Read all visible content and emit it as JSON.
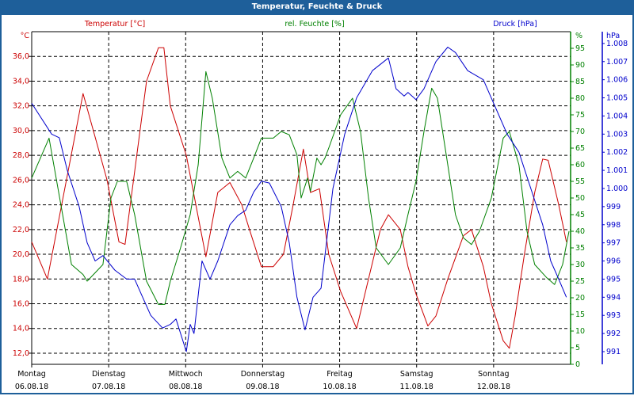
{
  "window": {
    "title": "Temperatur, Feuchte & Druck"
  },
  "chart_data": {
    "type": "line",
    "title": "Temperatur, Feuchte & Druck",
    "x_unit": "hours since Montag 06.08.18 00:00",
    "xlim": [
      0,
      168
    ],
    "days": [
      {
        "name": "Montag",
        "date": "06.08.18"
      },
      {
        "name": "Dienstag",
        "date": "07.08.18"
      },
      {
        "name": "Mittwoch",
        "date": "08.08.18"
      },
      {
        "name": "Donnerstag",
        "date": "09.08.18"
      },
      {
        "name": "Freitag",
        "date": "10.08.18"
      },
      {
        "name": "Samstag",
        "date": "11.08.18"
      },
      {
        "name": "Sonntag",
        "date": "12.08.18"
      }
    ],
    "axes": {
      "temp": {
        "label": "Temperatur [°C]",
        "unit": "°C",
        "ylim": [
          11.1,
          38
        ],
        "ticks": [
          "12,0",
          "14,0",
          "16,0",
          "18,0",
          "20,0",
          "22,0",
          "24,0",
          "26,0",
          "28,0",
          "30,0",
          "32,0",
          "34,0",
          "36,0"
        ],
        "tick_values": [
          12,
          14,
          16,
          18,
          20,
          22,
          24,
          26,
          28,
          30,
          32,
          34,
          36
        ],
        "color": "#cc0000"
      },
      "hum": {
        "label": "rel. Feuchte [%]",
        "unit": "%",
        "ylim": [
          0,
          100
        ],
        "ticks": [
          "0",
          "5",
          "10",
          "15",
          "20",
          "25",
          "30",
          "35",
          "40",
          "45",
          "50",
          "55",
          "60",
          "65",
          "70",
          "75",
          "80",
          "85",
          "90",
          "95"
        ],
        "tick_values": [
          0,
          5,
          10,
          15,
          20,
          25,
          30,
          35,
          40,
          45,
          50,
          55,
          60,
          65,
          70,
          75,
          80,
          85,
          90,
          95
        ],
        "color": "#008000"
      },
      "press": {
        "label": "Druck [hPa]",
        "unit": "hPa",
        "ylim": [
          990.3,
          1008.65
        ],
        "ticks": [
          "991",
          "992",
          "993",
          "994",
          "995",
          "996",
          "997",
          "998",
          "999",
          "1.000",
          "1.001",
          "1.002",
          "1.003",
          "1.004",
          "1.005",
          "1.006",
          "1.007",
          "1.008"
        ],
        "tick_values": [
          991,
          992,
          993,
          994,
          995,
          996,
          997,
          998,
          999,
          1000,
          1001,
          1002,
          1003,
          1004,
          1005,
          1006,
          1007,
          1008
        ],
        "color": "#0000cc"
      }
    },
    "series": [
      {
        "name": "Temperatur",
        "axis": "temp",
        "color": "#cc0000",
        "points": [
          [
            0,
            21
          ],
          [
            4.9,
            18
          ],
          [
            16,
            33
          ],
          [
            23.5,
            26
          ],
          [
            27.2,
            21
          ],
          [
            29.1,
            20.8
          ],
          [
            35.8,
            34
          ],
          [
            39.5,
            36.7
          ],
          [
            41.2,
            36.7
          ],
          [
            43.2,
            32
          ],
          [
            48.2,
            28
          ],
          [
            54.3,
            19.8
          ],
          [
            58,
            25
          ],
          [
            61.8,
            25.8
          ],
          [
            65.5,
            24
          ],
          [
            67.9,
            22
          ],
          [
            71.6,
            19
          ],
          [
            75.3,
            19
          ],
          [
            78.5,
            20
          ],
          [
            81.5,
            24
          ],
          [
            84.7,
            28.5
          ],
          [
            86.9,
            25
          ],
          [
            89.7,
            25.3
          ],
          [
            92.6,
            20
          ],
          [
            96.3,
            17
          ],
          [
            101.3,
            14
          ],
          [
            105,
            18
          ],
          [
            108.7,
            22
          ],
          [
            111.2,
            23.2
          ],
          [
            114.9,
            22
          ],
          [
            117.3,
            19
          ],
          [
            119.8,
            16.8
          ],
          [
            123.5,
            14.2
          ],
          [
            126,
            15
          ],
          [
            129.7,
            18
          ],
          [
            134.6,
            21.5
          ],
          [
            137.1,
            22
          ],
          [
            140.8,
            19
          ],
          [
            143.3,
            16
          ],
          [
            147,
            13
          ],
          [
            148.9,
            12.4
          ],
          [
            150.7,
            15
          ],
          [
            153.6,
            20
          ],
          [
            156.8,
            25
          ],
          [
            159.3,
            27.7
          ],
          [
            161,
            27.6
          ],
          [
            164.3,
            24
          ],
          [
            166.7,
            21
          ]
        ]
      },
      {
        "name": "rel. Feuchte",
        "axis": "hum",
        "color": "#008000",
        "points": [
          [
            0,
            56
          ],
          [
            5.4,
            68
          ],
          [
            12.4,
            30
          ],
          [
            16,
            27
          ],
          [
            17.3,
            25
          ],
          [
            22.2,
            30
          ],
          [
            24.7,
            50
          ],
          [
            26.7,
            55
          ],
          [
            29.6,
            55
          ],
          [
            32.1,
            45
          ],
          [
            35.8,
            25
          ],
          [
            39.5,
            18
          ],
          [
            41.5,
            18
          ],
          [
            43.2,
            25
          ],
          [
            46.4,
            35
          ],
          [
            49.4,
            45
          ],
          [
            51.9,
            60
          ],
          [
            54.3,
            88
          ],
          [
            56.3,
            80
          ],
          [
            59.3,
            62
          ],
          [
            61.8,
            56
          ],
          [
            64.2,
            58
          ],
          [
            66.7,
            56
          ],
          [
            69.2,
            62
          ],
          [
            71.6,
            68
          ],
          [
            75.3,
            68
          ],
          [
            77.8,
            70
          ],
          [
            80.3,
            69
          ],
          [
            82.7,
            63
          ],
          [
            84,
            50
          ],
          [
            86,
            56
          ],
          [
            86.9,
            52
          ],
          [
            88.9,
            62
          ],
          [
            90.2,
            60
          ],
          [
            91.4,
            62
          ],
          [
            92.6,
            65
          ],
          [
            96.3,
            75
          ],
          [
            100,
            80
          ],
          [
            102.5,
            70
          ],
          [
            105,
            50
          ],
          [
            107.4,
            35
          ],
          [
            111.2,
            30
          ],
          [
            114.9,
            35
          ],
          [
            117.3,
            45
          ],
          [
            119.8,
            55
          ],
          [
            122.3,
            70
          ],
          [
            124.7,
            83
          ],
          [
            126.5,
            80
          ],
          [
            129.7,
            60
          ],
          [
            132.1,
            45
          ],
          [
            134.6,
            38
          ],
          [
            137.1,
            36
          ],
          [
            139.6,
            40
          ],
          [
            143.3,
            50
          ],
          [
            147,
            68
          ],
          [
            148.9,
            70
          ],
          [
            151.9,
            60
          ],
          [
            154.4,
            40
          ],
          [
            156.8,
            30
          ],
          [
            160.6,
            26
          ],
          [
            163,
            24
          ],
          [
            165.5,
            30
          ],
          [
            167.5,
            40
          ]
        ]
      },
      {
        "name": "Druck",
        "axis": "press",
        "color": "#0000cc",
        "points": [
          [
            0,
            1004.7
          ],
          [
            6.2,
            1003
          ],
          [
            8.6,
            1002.8
          ],
          [
            11.1,
            1001
          ],
          [
            14.8,
            999
          ],
          [
            17.3,
            997
          ],
          [
            19.8,
            996
          ],
          [
            22.2,
            996.3
          ],
          [
            25.9,
            995.5
          ],
          [
            29.6,
            995
          ],
          [
            32.1,
            995
          ],
          [
            34.6,
            994
          ],
          [
            37.1,
            993
          ],
          [
            40.8,
            992.3
          ],
          [
            43.2,
            992.5
          ],
          [
            45,
            992.8
          ],
          [
            48.2,
            991
          ],
          [
            49.4,
            992.5
          ],
          [
            50.6,
            992
          ],
          [
            53.1,
            996
          ],
          [
            55.6,
            995
          ],
          [
            58,
            996
          ],
          [
            61.8,
            998
          ],
          [
            64.2,
            998.5
          ],
          [
            66.7,
            998.8
          ],
          [
            69.2,
            999.8
          ],
          [
            71.6,
            1000.4
          ],
          [
            74.1,
            1000.3
          ],
          [
            77.8,
            999
          ],
          [
            80.3,
            997
          ],
          [
            82.7,
            994
          ],
          [
            85.2,
            992.2
          ],
          [
            87.7,
            994
          ],
          [
            90.2,
            994.5
          ],
          [
            93.9,
            1000
          ],
          [
            97.6,
            1003
          ],
          [
            101.3,
            1005
          ],
          [
            106.2,
            1006.5
          ],
          [
            111.2,
            1007.2
          ],
          [
            113.6,
            1005.5
          ],
          [
            116.1,
            1005.1
          ],
          [
            117.3,
            1005.3
          ],
          [
            119.8,
            1004.9
          ],
          [
            122.3,
            1005.5
          ],
          [
            126,
            1007
          ],
          [
            129.7,
            1007.8
          ],
          [
            132.1,
            1007.5
          ],
          [
            135.9,
            1006.5
          ],
          [
            140.8,
            1006
          ],
          [
            144.5,
            1004.5
          ],
          [
            148.2,
            1003
          ],
          [
            151.9,
            1002
          ],
          [
            155.6,
            1000
          ],
          [
            159.3,
            998
          ],
          [
            161.8,
            996
          ],
          [
            164.3,
            995
          ],
          [
            166.7,
            994
          ]
        ]
      }
    ]
  }
}
